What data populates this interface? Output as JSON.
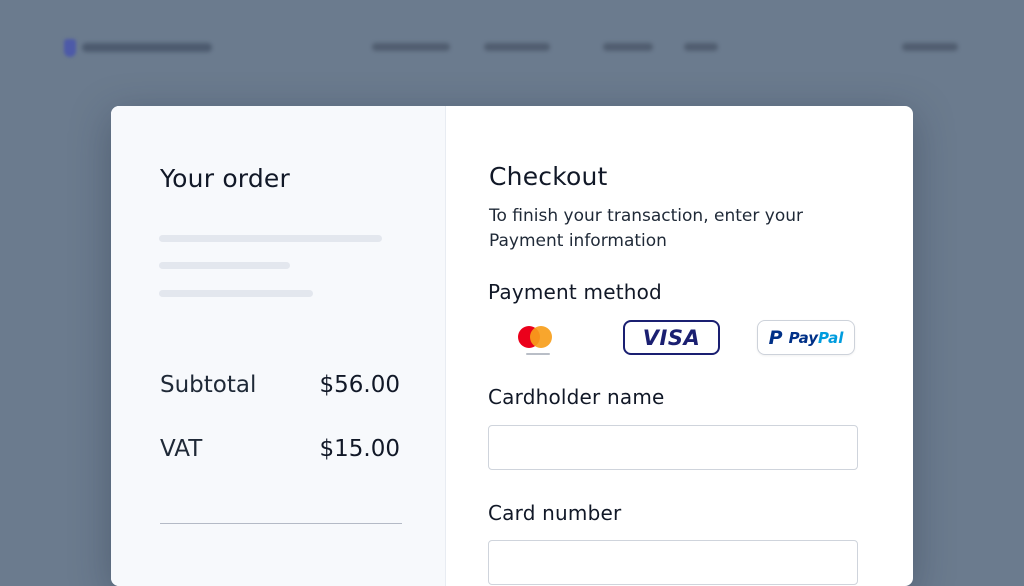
{
  "colors": {
    "backdrop": "#6b7b8e",
    "card": "#ffffff",
    "order_pane": "#f7f9fc",
    "visa_blue": "#1a1f71",
    "paypal_dark": "#003087",
    "paypal_light": "#009cde"
  },
  "order": {
    "title": "Your order",
    "summary": [
      {
        "label": "Subtotal",
        "value": "$56.00"
      },
      {
        "label": "VAT",
        "value": "$15.00"
      }
    ]
  },
  "checkout": {
    "title": "Checkout",
    "subtitle_line1": "To finish your transaction, enter your",
    "subtitle_line2": "Payment information",
    "payment_method_label": "Payment method",
    "payment_options": [
      {
        "icon": "mastercard-icon"
      },
      {
        "label": "VISA",
        "icon": "visa-icon"
      },
      {
        "label_a": "Pay",
        "label_b": "Pal",
        "icon": "paypal-icon"
      }
    ],
    "cardholder_label": "Cardholder name",
    "cardholder_value": "",
    "card_number_label": "Card number",
    "card_number_value": ""
  }
}
